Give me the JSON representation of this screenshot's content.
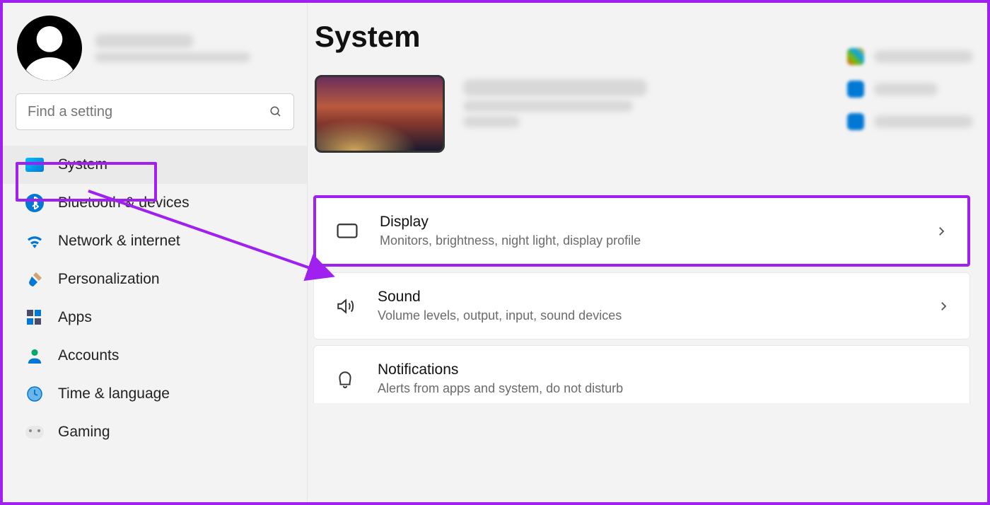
{
  "search": {
    "placeholder": "Find a setting"
  },
  "page": {
    "title": "System"
  },
  "sidebar": {
    "items": [
      {
        "label": "System"
      },
      {
        "label": "Bluetooth & devices"
      },
      {
        "label": "Network & internet"
      },
      {
        "label": "Personalization"
      },
      {
        "label": "Apps"
      },
      {
        "label": "Accounts"
      },
      {
        "label": "Time & language"
      },
      {
        "label": "Gaming"
      }
    ]
  },
  "settings": {
    "display": {
      "title": "Display",
      "sub": "Monitors, brightness, night light, display profile"
    },
    "sound": {
      "title": "Sound",
      "sub": "Volume levels, output, input, sound devices"
    },
    "notifications": {
      "title": "Notifications",
      "sub": "Alerts from apps and system, do not disturb"
    }
  },
  "annotation": {
    "highlight": "purple",
    "arrow_from": "sidebar-system",
    "arrow_to": "display-card"
  }
}
